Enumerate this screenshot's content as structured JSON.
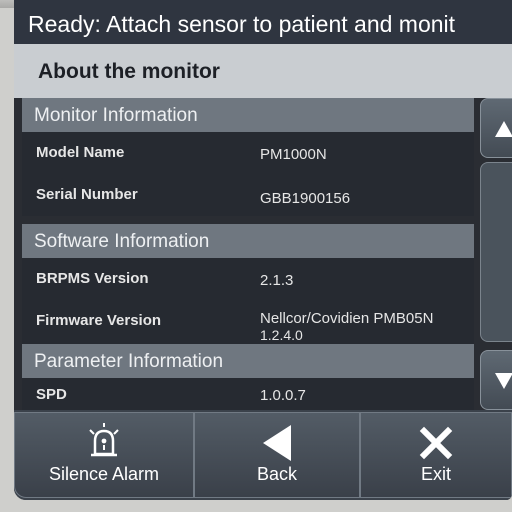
{
  "status_bar": {
    "text": "Ready: Attach sensor to patient and monit"
  },
  "title": "About the monitor",
  "sections": {
    "monitor": {
      "header": "Monitor Information",
      "rows": [
        {
          "label": "Model Name",
          "value": "PM1000N"
        },
        {
          "label": "Serial Number",
          "value": "GBB1900156"
        }
      ]
    },
    "software": {
      "header": "Software Information",
      "rows": [
        {
          "label": "BRPMS Version",
          "value": "2.1.3"
        },
        {
          "label": "Firmware Version",
          "value": "Nellcor/Covidien PMB05N",
          "value2": "1.2.4.0"
        }
      ]
    },
    "parameter": {
      "header": "Parameter Information",
      "rows": [
        {
          "label": "SPD",
          "value": "1.0.0.7"
        }
      ]
    }
  },
  "scroll": {
    "up_icon": "triangle-up-icon",
    "down_icon": "triangle-down-icon"
  },
  "footer": {
    "silence": {
      "label": "Silence Alarm",
      "icon": "alarm-bell-icon"
    },
    "back": {
      "label": "Back",
      "icon": "back-arrow-icon"
    },
    "exit": {
      "label": "Exit",
      "icon": "close-x-icon"
    }
  },
  "colors": {
    "status_bar": "#2f3540",
    "title_bar": "#c9cdd1",
    "section_header": "#6f7780",
    "row_bg": "#262a31",
    "button": "#4a525c"
  }
}
